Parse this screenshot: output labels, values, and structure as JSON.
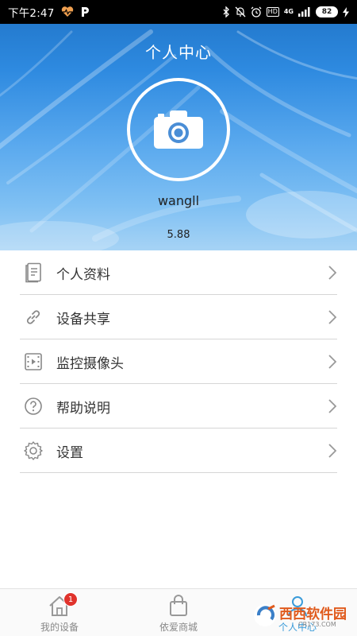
{
  "status_bar": {
    "time": "下午2:47",
    "network": "4G",
    "hd": "HD",
    "battery": "82"
  },
  "header": {
    "title": "个人中心",
    "username": "wangll",
    "version": "5.88"
  },
  "menu": [
    {
      "label": "个人资料",
      "icon": "document-icon"
    },
    {
      "label": "设备共享",
      "icon": "link-icon"
    },
    {
      "label": "监控摄像头",
      "icon": "film-icon"
    },
    {
      "label": "帮助说明",
      "icon": "help-icon"
    },
    {
      "label": "设置",
      "icon": "gear-icon"
    }
  ],
  "tabs": [
    {
      "label": "我的设备",
      "badge": "1",
      "active": false
    },
    {
      "label": "依爱商城",
      "active": false
    },
    {
      "label": "个人中心",
      "active": true
    }
  ],
  "watermark": {
    "text": "西西软件园",
    "subtext": "CR173.COM"
  },
  "colors": {
    "accent": "#3a9bd9",
    "badge": "#e0332c",
    "sky_top": "#1f73c6",
    "sky_bottom": "#a6d3f5"
  }
}
